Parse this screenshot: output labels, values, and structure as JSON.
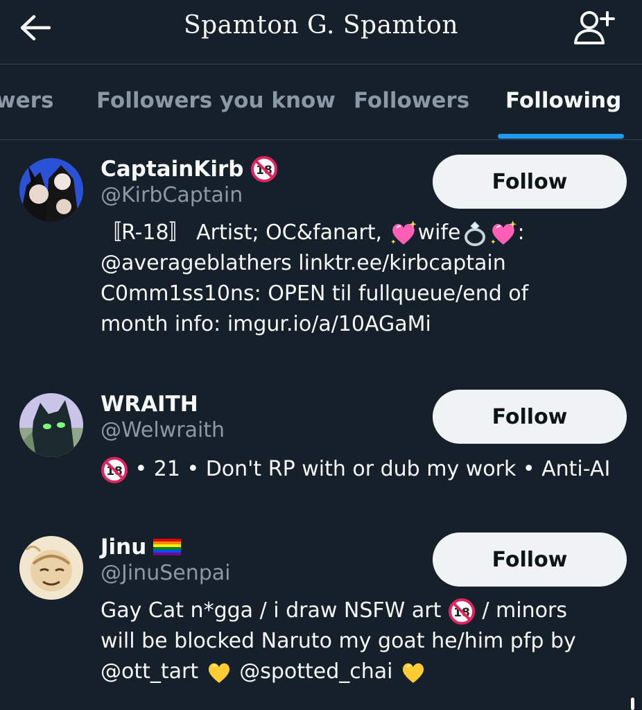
{
  "header": {
    "title": "Spamton G. Spamton"
  },
  "tabs": [
    {
      "label": "wers",
      "active": false
    },
    {
      "label": "Followers you know",
      "active": false
    },
    {
      "label": "Followers",
      "active": false
    },
    {
      "label": "Following",
      "active": true
    }
  ],
  "users": [
    {
      "name": "CaptainKirb",
      "handle": "@KirbCaptain",
      "follow_label": "Follow",
      "bio": {
        "part1": "〚R-18〛 Artist; OC&fanart, ",
        "part2": "wife",
        "part3": ":",
        "line2": "@averageblathers linktr.ee/kirbcaptain",
        "line3": "C0mm1ss10ns: OPEN til fullqueue/end of",
        "line4": "month info: imgur.io/a/10AGaMi"
      }
    },
    {
      "name": "WRAITH",
      "handle": "@Welwraith",
      "follow_label": "Follow",
      "bio": {
        "text": " • 21 • Don't RP with or dub my work • Anti-AI"
      }
    },
    {
      "name": "Jinu",
      "handle": "@JinuSenpai",
      "follow_label": "Follow",
      "bio": {
        "part1": "Gay Cat n*gga / i draw NSFW art ",
        "part2": " / minors",
        "line2": "will be blocked Naruto my goat he/him pfp by",
        "part3": "@ott_tart ",
        "part4": " @spotted_chai "
      }
    }
  ],
  "icons": {
    "back": "arrow-left-icon",
    "add_user": "add-user-icon",
    "adult_badge": "no-under-18-icon",
    "sparkling_heart": "sparkling-heart-icon",
    "ring": "ring-icon",
    "yellow_heart": "yellow-heart-icon",
    "rainbow_flag": "rainbow-flag-icon"
  },
  "colors": {
    "background": "#15202b",
    "accent": "#1d9bf0",
    "secondary_text": "#8b98a5",
    "button_bg": "#eff3f4"
  }
}
